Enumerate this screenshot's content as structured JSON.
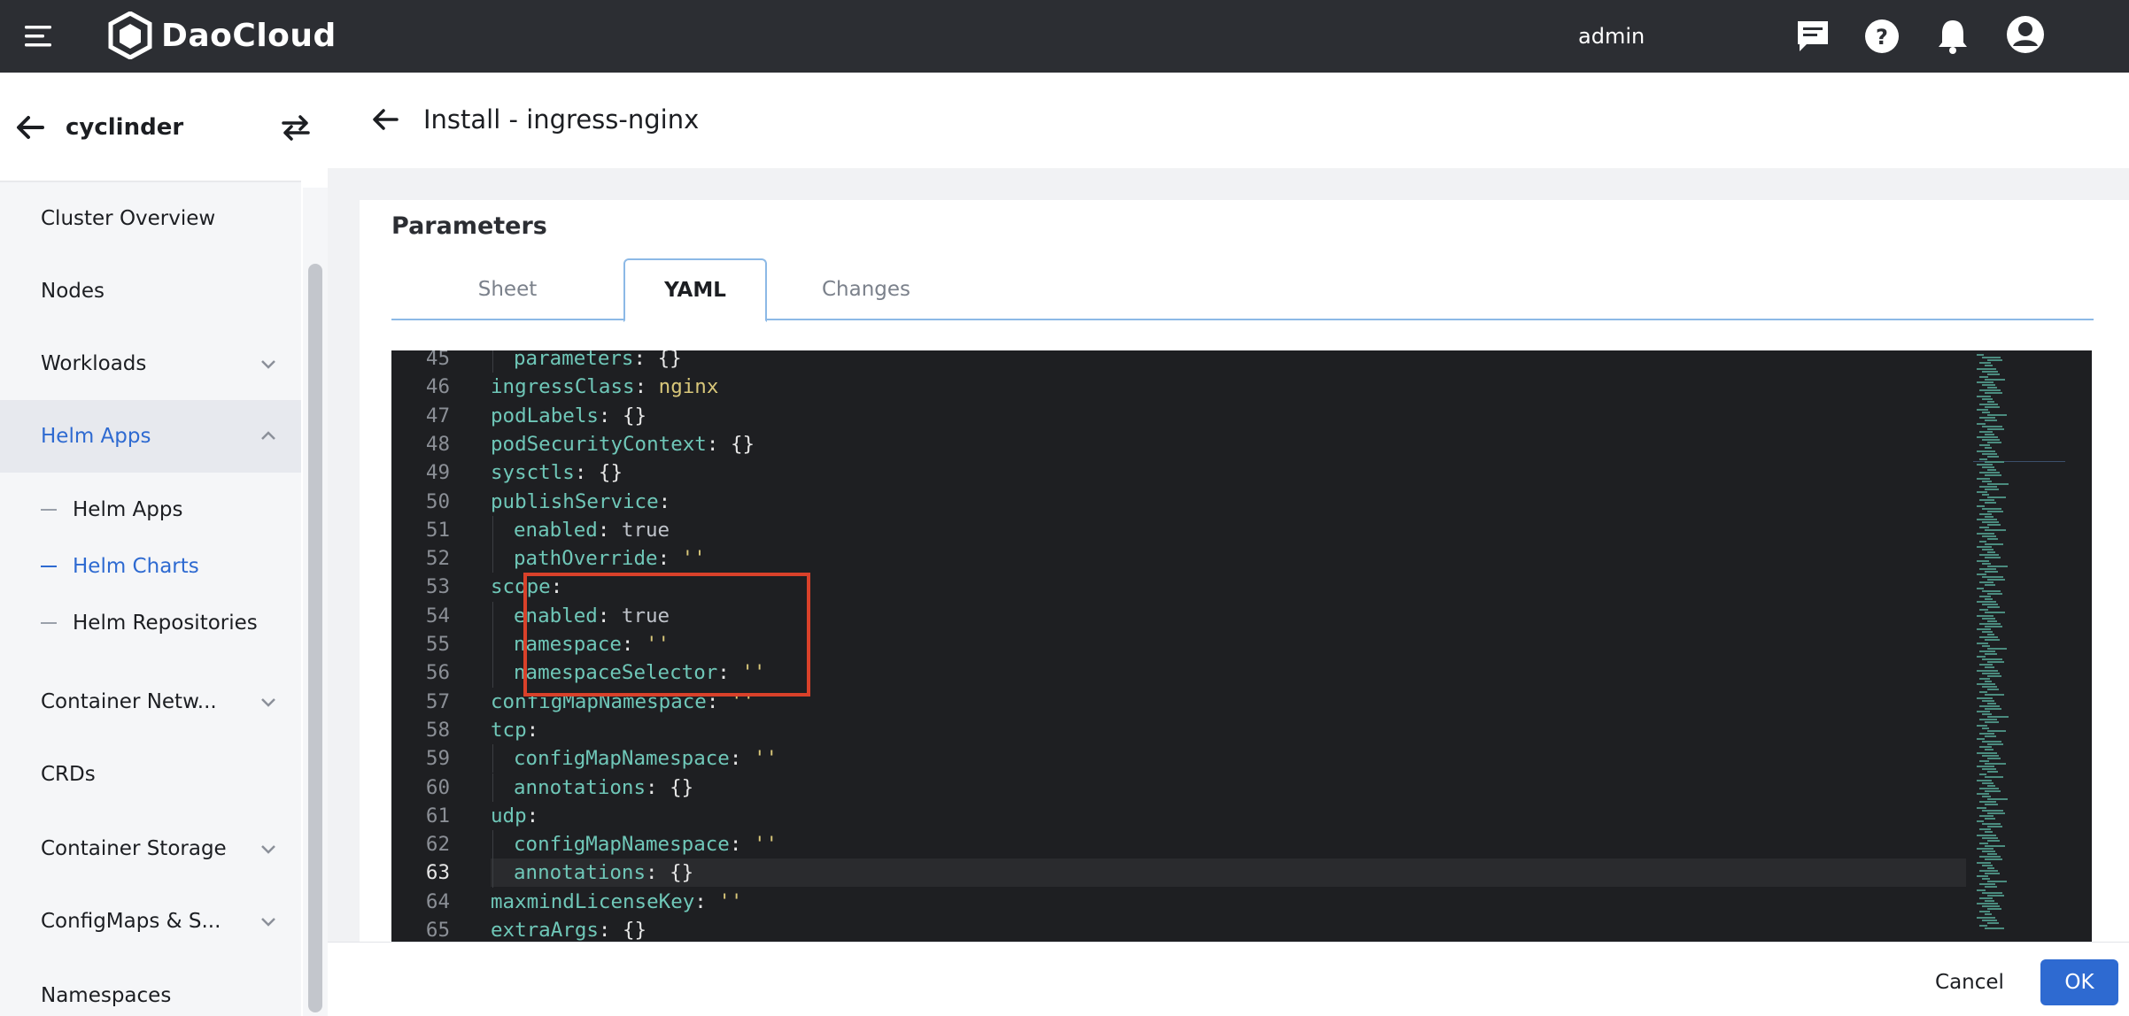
{
  "app": {
    "brand": "DaoCloud",
    "user": "admin",
    "icons": {
      "menu": "hamburger-menu-icon",
      "logo": "daocloud-logo-icon",
      "messages": "message-icon",
      "help": "help-icon",
      "notifications": "bell-icon",
      "avatar": "user-avatar-icon"
    }
  },
  "sidebar": {
    "cluster_name": "cyclinder",
    "items": [
      {
        "label": "Cluster Overview",
        "expandable": false
      },
      {
        "label": "Nodes",
        "expandable": false
      },
      {
        "label": "Workloads",
        "expandable": true
      },
      {
        "label": "Helm Apps",
        "expandable": true,
        "expanded": true
      },
      {
        "label": "Container Netw...",
        "expandable": true
      },
      {
        "label": "CRDs",
        "expandable": false
      },
      {
        "label": "Container Storage",
        "expandable": true
      },
      {
        "label": "ConfigMaps & S...",
        "expandable": true
      },
      {
        "label": "Namespaces",
        "expandable": false
      }
    ],
    "helm_sub": [
      {
        "label": "Helm Apps"
      },
      {
        "label": "Helm Charts",
        "selected": true
      },
      {
        "label": "Helm Repositories"
      }
    ]
  },
  "page": {
    "title": "Install - ingress-nginx",
    "section_title": "Parameters",
    "tabs": [
      "Sheet",
      "YAML",
      "Changes"
    ],
    "active_tab": "YAML"
  },
  "editor": {
    "current_line": 63,
    "lines": [
      {
        "n": 45,
        "indent": 2,
        "key": "parameters",
        "val": "{}",
        "type": "plain"
      },
      {
        "n": 46,
        "indent": 1,
        "key": "ingressClass",
        "val": "nginx",
        "type": "str"
      },
      {
        "n": 47,
        "indent": 1,
        "key": "podLabels",
        "val": "{}",
        "type": "plain"
      },
      {
        "n": 48,
        "indent": 1,
        "key": "podSecurityContext",
        "val": "{}",
        "type": "plain"
      },
      {
        "n": 49,
        "indent": 1,
        "key": "sysctls",
        "val": "{}",
        "type": "plain"
      },
      {
        "n": 50,
        "indent": 1,
        "key": "publishService",
        "val": "",
        "type": "plain"
      },
      {
        "n": 51,
        "indent": 2,
        "key": "enabled",
        "val": "true",
        "type": "bool"
      },
      {
        "n": 52,
        "indent": 2,
        "key": "pathOverride",
        "val": "''",
        "type": "str"
      },
      {
        "n": 53,
        "indent": 1,
        "key": "scope",
        "val": "",
        "type": "plain"
      },
      {
        "n": 54,
        "indent": 2,
        "key": "enabled",
        "val": "true",
        "type": "bool"
      },
      {
        "n": 55,
        "indent": 2,
        "key": "namespace",
        "val": "''",
        "type": "str"
      },
      {
        "n": 56,
        "indent": 2,
        "key": "namespaceSelector",
        "val": "''",
        "type": "str"
      },
      {
        "n": 57,
        "indent": 1,
        "key": "configMapNamespace",
        "val": "''",
        "type": "str"
      },
      {
        "n": 58,
        "indent": 1,
        "key": "tcp",
        "val": "",
        "type": "plain"
      },
      {
        "n": 59,
        "indent": 2,
        "key": "configMapNamespace",
        "val": "''",
        "type": "str"
      },
      {
        "n": 60,
        "indent": 2,
        "key": "annotations",
        "val": "{}",
        "type": "plain"
      },
      {
        "n": 61,
        "indent": 1,
        "key": "udp",
        "val": "",
        "type": "plain"
      },
      {
        "n": 62,
        "indent": 2,
        "key": "configMapNamespace",
        "val": "''",
        "type": "str"
      },
      {
        "n": 63,
        "indent": 2,
        "key": "annotations",
        "val": "{}",
        "type": "plain"
      },
      {
        "n": 64,
        "indent": 1,
        "key": "maxmindLicenseKey",
        "val": "''",
        "type": "str"
      },
      {
        "n": 65,
        "indent": 1,
        "key": "extraArgs",
        "val": "{}",
        "type": "plain"
      }
    ]
  },
  "footer": {
    "cancel_label": "Cancel",
    "ok_label": "OK"
  },
  "colors": {
    "accent": "#2e6ad1",
    "topbar": "#2c2e33",
    "highlight_box": "#d9412a",
    "yaml_key": "#6fc7b8",
    "yaml_string": "#d9c77a"
  }
}
